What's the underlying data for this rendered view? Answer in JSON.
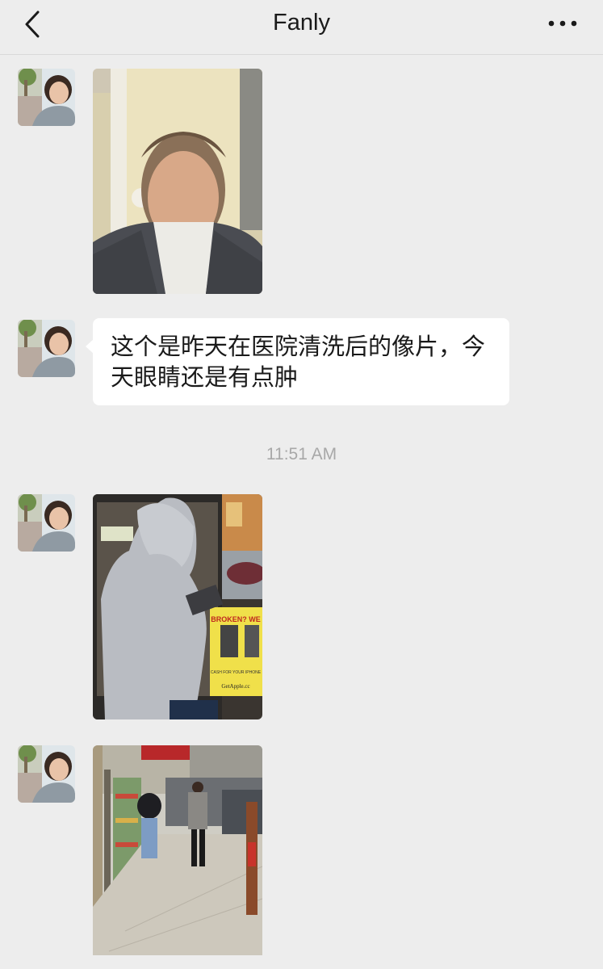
{
  "header": {
    "title": "Fanly",
    "back_icon": "chevron-left-icon",
    "more_icon": "ellipsis-icon"
  },
  "messages": [
    {
      "type": "image",
      "sender": "Fanly",
      "content": "selfie photo of a woman indoors"
    },
    {
      "type": "text",
      "sender": "Fanly",
      "text": "这个是昨天在医院清洗后的像片，今天眼睛还是有点肿"
    },
    {
      "type": "timestamp",
      "text": "11:51 AM"
    },
    {
      "type": "image",
      "sender": "Fanly",
      "content": "person in grey hooded jacket at a storefront"
    },
    {
      "type": "image",
      "sender": "Fanly",
      "content": "city street sidewalk with pedestrians"
    }
  ],
  "store_sign": {
    "line1": "BROKEN? WE",
    "line2": "CASH FOR YOUR IPHONE",
    "line3": "GetApple.cc"
  },
  "colors": {
    "background": "#ededed",
    "bubble": "#ffffff",
    "timestamp": "#a8a8a8"
  }
}
